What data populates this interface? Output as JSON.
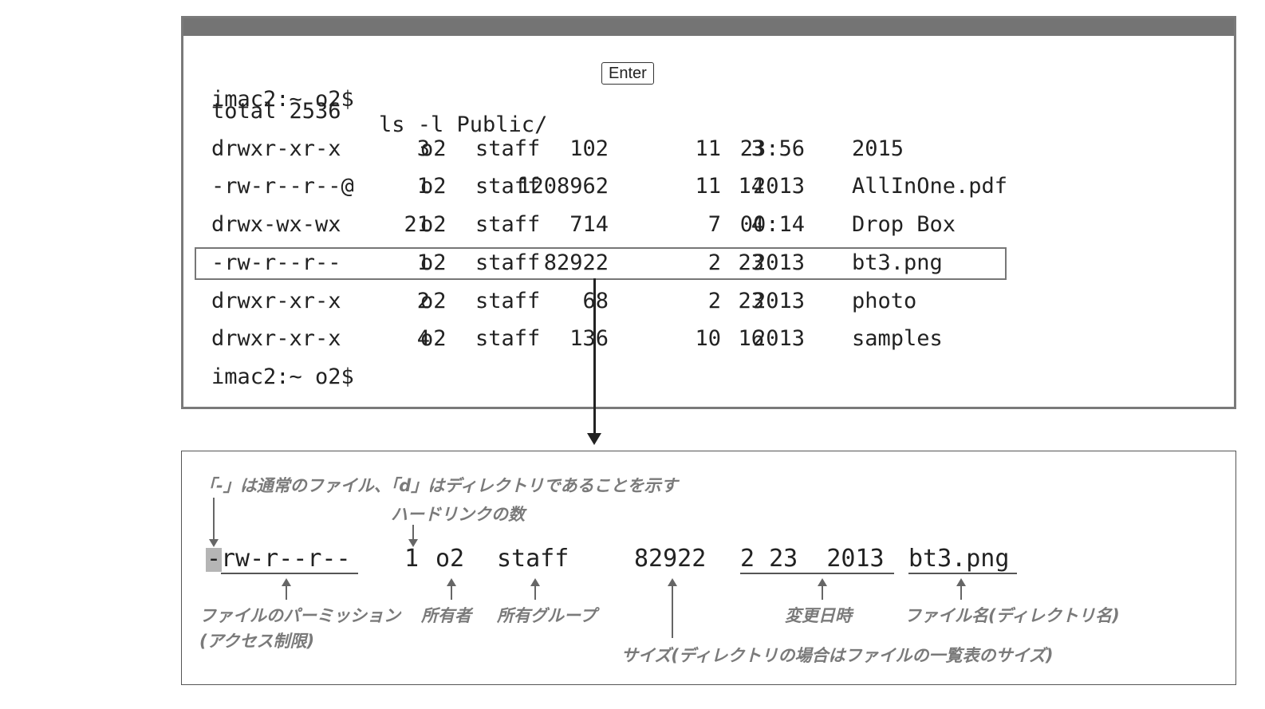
{
  "terminal": {
    "prompt_line": {
      "prompt": "imac2:~ o2$",
      "command": "ls -l Public/",
      "key": "Enter"
    },
    "total_line": "total 2536",
    "columns": [
      "permissions",
      "links",
      "owner",
      "group",
      "size",
      "month",
      "day",
      "time_or_year",
      "name"
    ],
    "rows": [
      {
        "perm": "drwxr-xr-x",
        "links": "3",
        "owner": "o2",
        "group": "staff",
        "size": "102",
        "month": "11",
        "day": "3",
        "time": "23:56",
        "name": "2015"
      },
      {
        "perm": "-rw-r--r--@",
        "links": "1",
        "owner": "o2",
        "group": "staff",
        "size": "1208962",
        "month": "11",
        "day": "14",
        "time": "2013",
        "name": "AllInOne.pdf"
      },
      {
        "perm": "drwx-wx-wx",
        "links": "21",
        "owner": "o2",
        "group": "staff",
        "size": "714",
        "month": "7",
        "day": "4",
        "time": "00:14",
        "name": "Drop Box"
      },
      {
        "perm": "-rw-r--r--",
        "links": "1",
        "owner": "o2",
        "group": "staff",
        "size": "82922",
        "month": "2",
        "day": "23",
        "time": "2013",
        "name": "bt3.png",
        "highlighted": true
      },
      {
        "perm": "drwxr-xr-x",
        "links": "2",
        "owner": "o2",
        "group": "staff",
        "size": "68",
        "month": "2",
        "day": "23",
        "time": "2013",
        "name": "photo"
      },
      {
        "perm": "drwxr-xr-x",
        "links": "4",
        "owner": "o2",
        "group": "staff",
        "size": "136",
        "month": "10",
        "day": "16",
        "time": "2013",
        "name": "samples"
      }
    ],
    "end_prompt": "imac2:~ o2$"
  },
  "explanation": {
    "top_note": "「-」は通常のファイル、「d」はディレクトリであることを示す",
    "hardlink_note": "ハードリンクの数",
    "example": {
      "type_char": "-",
      "perm_rest": "rw-r--r--",
      "links": "1",
      "owner": "o2",
      "group": "staff",
      "size": "82922",
      "date": "2 23  2013",
      "name": "bt3.png"
    },
    "labels": {
      "permission": "ファイルのパーミッション",
      "permission_sub": "(アクセス制限)",
      "owner": "所有者",
      "group": "所有グループ",
      "modified": "変更日時",
      "filename": "ファイル名(ディレクトリ名)",
      "size": "サイズ(ディレクトリの場合はファイルの一覧表のサイズ)"
    }
  },
  "colors": {
    "titlebar": "#747474",
    "annotation": "#7a7a7a",
    "type_highlight": "#b5b5b5"
  }
}
